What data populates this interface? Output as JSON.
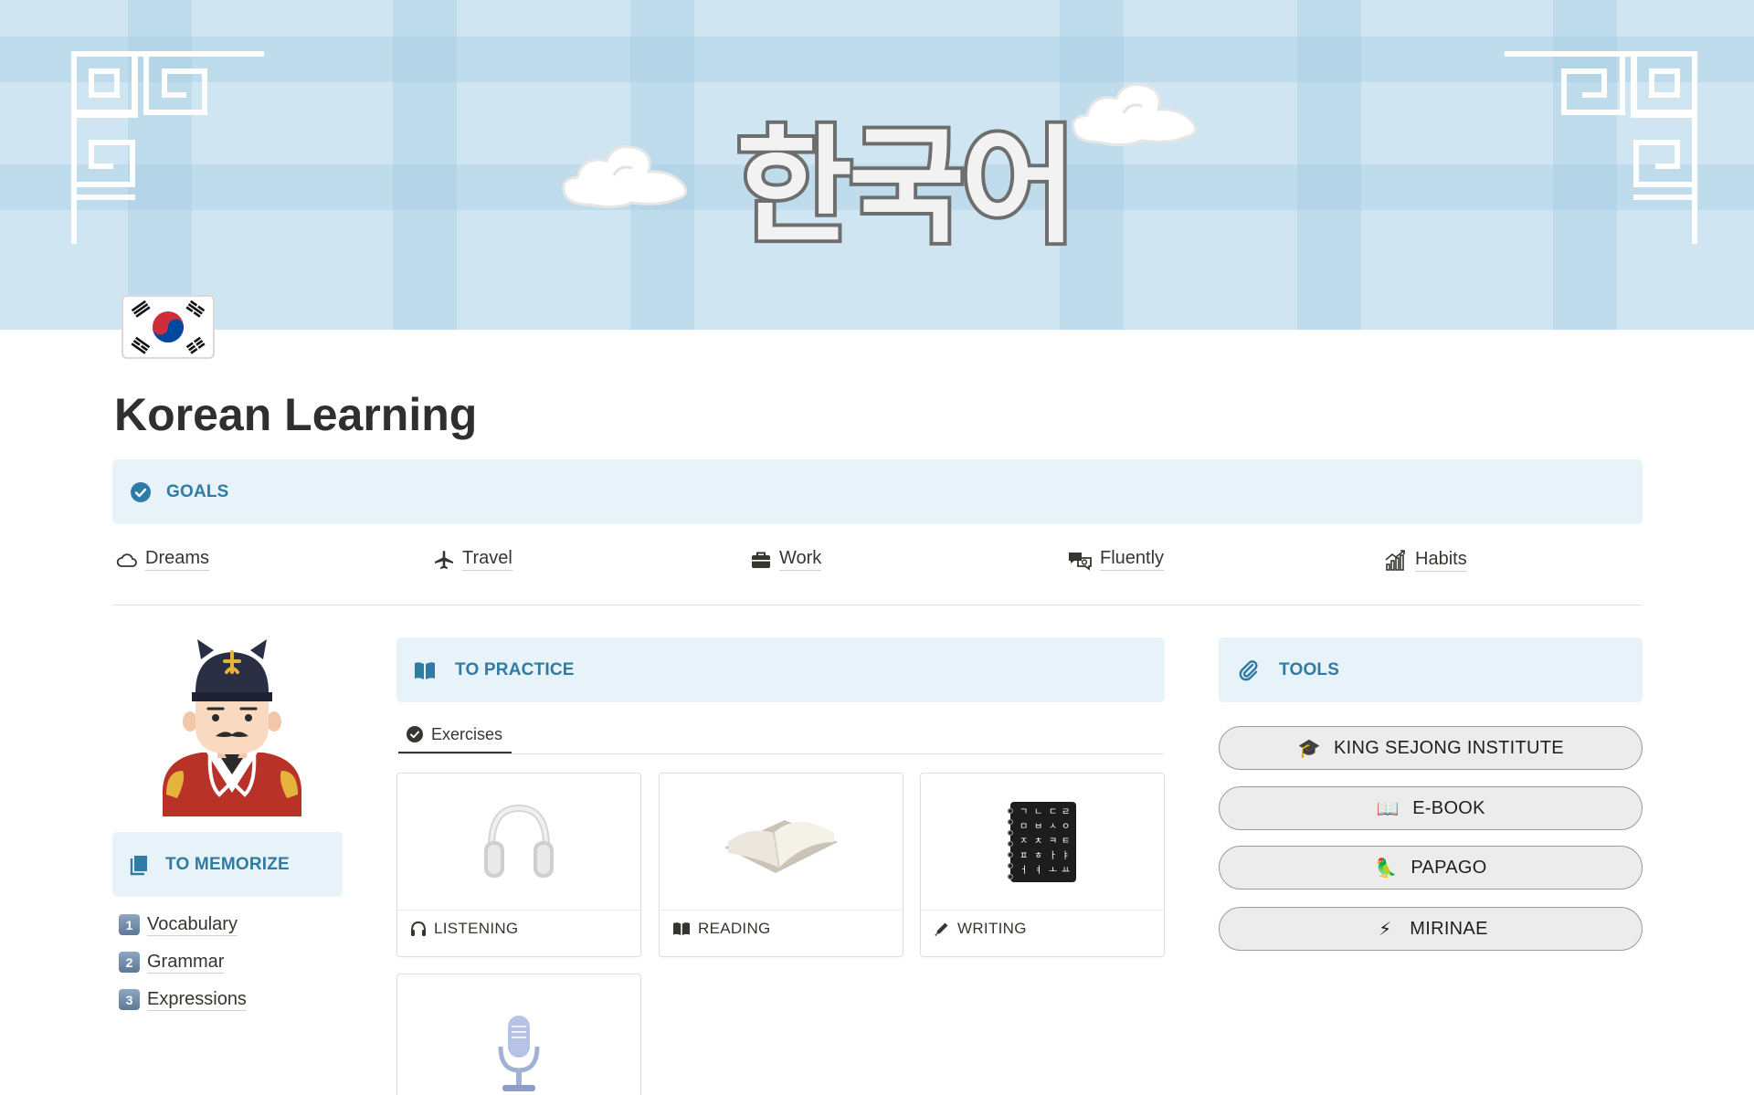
{
  "cover": {
    "title": "한국어"
  },
  "page": {
    "title": "Korean Learning"
  },
  "goals": {
    "label": "GOALS",
    "items": [
      {
        "label": "Dreams",
        "icon": "cloud-icon"
      },
      {
        "label": "Travel",
        "icon": "airplane-icon"
      },
      {
        "label": "Work",
        "icon": "briefcase-icon"
      },
      {
        "label": "Fluently",
        "icon": "chat-bubbles-icon"
      },
      {
        "label": "Habits",
        "icon": "chart-icon"
      }
    ]
  },
  "memorize": {
    "label": "TO MEMORIZE",
    "items": [
      {
        "num": "1",
        "label": "Vocabulary"
      },
      {
        "num": "2",
        "label": "Grammar"
      },
      {
        "num": "3",
        "label": "Expressions"
      }
    ]
  },
  "practice": {
    "label": "TO PRACTICE",
    "tab": "Exercises",
    "cards": [
      {
        "label": "LISTENING",
        "icon": "headphones-icon"
      },
      {
        "label": "READING",
        "icon": "book-icon"
      },
      {
        "label": "WRITING",
        "icon": "pencil-icon"
      },
      {
        "label": "",
        "icon": "microphone-icon"
      }
    ]
  },
  "tools": {
    "label": "TOOLS",
    "buttons": [
      {
        "emoji": "🎓",
        "label": "KING SEJONG INSTITUTE"
      },
      {
        "emoji": "📖",
        "label": "E-BOOK"
      },
      {
        "emoji": "🦜",
        "label": "PAPAGO"
      },
      {
        "emoji": "⚡",
        "label": "MIRINAE"
      }
    ]
  },
  "colors": {
    "callout_bg": "#e7f3f9",
    "callout_text": "#2e7ba4",
    "cover_bg": "#cfe6f2"
  }
}
